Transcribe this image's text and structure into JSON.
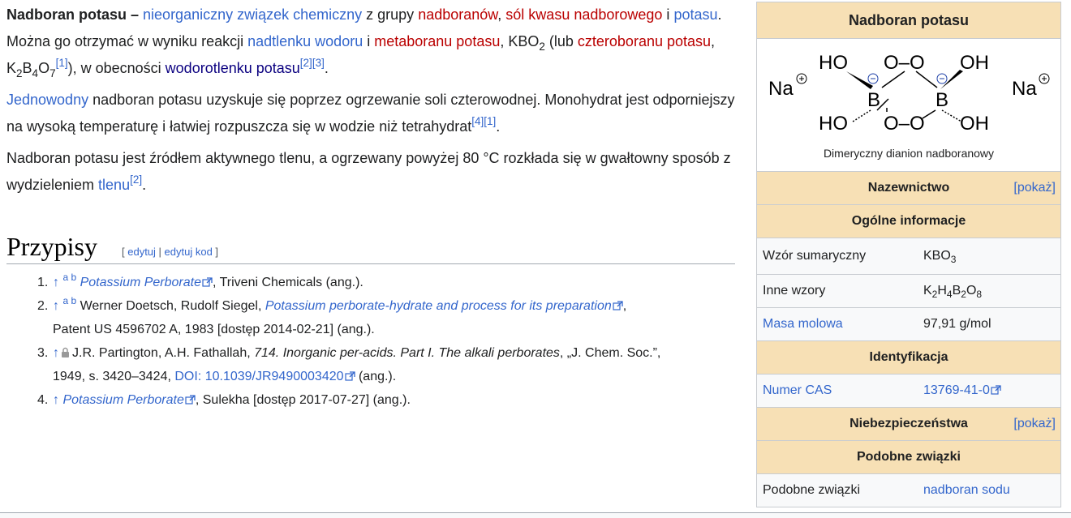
{
  "paragraphs": {
    "p1": {
      "title": "Nadboran potasu",
      "dash": " – ",
      "link1": "nieorganiczny związek chemiczny",
      "t1": " z grupy ",
      "link2": "nadboranów",
      "t2": ", ",
      "link3": "sól kwasu nadborowego",
      "t3": " i ",
      "link4": "potasu",
      "t4": ". Można go otrzymać w wyniku reakcji ",
      "link5": "nadtlenku wodoru",
      "t5": " i ",
      "link6": "metaboranu potasu",
      "t6": ", KBO",
      "sub1": "2",
      "t7": " (lub ",
      "link7": "czteroboranu potasu",
      "t8": ", K",
      "sub2": "2",
      "t9": "B",
      "sub3": "4",
      "t10": "O",
      "sub4": "7",
      "ref1": "[1]",
      "t11": "), w obecności ",
      "link8": "wodorotlenku potasu",
      "ref2": "[2]",
      "ref3": "[3]",
      "t12": "."
    },
    "p2": {
      "link1": "Jednowodny",
      "t1": " nadboran potasu uzyskuje się poprzez ogrzewanie soli czterowodnej. Monohydrat jest odporniejszy na wysoką temperaturę i łatwiej rozpuszcza się w wodzie niż tetrahydrat",
      "ref1": "[4]",
      "ref2": "[1]",
      "t2": "."
    },
    "p3": {
      "t1": "Nadboran potasu jest źródłem aktywnego tlenu, a ogrzewany powyżej 80 °C rozkłada się w gwałtowny sposób z wydzieleniem ",
      "link1": "tlenu",
      "ref1": "[2]",
      "t2": "."
    }
  },
  "references": {
    "heading": "Przypisy",
    "edit_bracket_open": "[ ",
    "edit_link": "edytuj",
    "edit_sep": " | ",
    "edit_code_link": "edytuj kod",
    "edit_bracket_close": " ]",
    "items": [
      {
        "num": "1.",
        "arrow": "↑",
        "ab": "a b",
        "title": "Potassium Perborate",
        "rest": ", Triveni Chemicals (ang.)."
      },
      {
        "num": "2.",
        "arrow": "↑",
        "ab": "a b",
        "authors": "Werner Doetsch, Rudolf Siegel, ",
        "title": "Potassium perborate-hydrate and process for its preparation",
        "rest": ",",
        "line2": "Patent US 4596702 A, 1983 [dostęp 2014-02-21] (ang.)."
      },
      {
        "num": "3.",
        "arrow": "↑",
        "authors": "J.R. Partington, A.H. Fathallah, ",
        "title": "714. Inorganic per-acids. Part I. The alkali perborates",
        "rest": ", „J. Chem. Soc.”,",
        "line2a": "1949, s. 3420–3424, ",
        "doi": "DOI: 10.1039/JR9490003420",
        "line2b": " (ang.)."
      },
      {
        "num": "4.",
        "arrow": "↑",
        "title": "Potassium Perborate",
        "rest": ", Sulekha [dostęp 2017-07-27] (ang.)."
      }
    ]
  },
  "infobox": {
    "title": "Nadboran potasu",
    "structure": {
      "na_left": "Na",
      "na_right": "Na",
      "ho_tl": "HO",
      "ho_bl": "HO",
      "oh_tr": "OH",
      "oh_br": "OH",
      "b1": "B",
      "b2": "B",
      "o_top": "O–O",
      "o_bottom": "O–O",
      "caption": "Dimeryczny dianion nadboranowy"
    },
    "section_naming": "Nazewnictwo",
    "pokaz": "[pokaż]",
    "section_general": "Ogólne informacje",
    "rows_general": [
      {
        "key": "Wzór sumaryczny",
        "val_main": "KBO",
        "val_sub": "3"
      },
      {
        "key": "Inne wzory",
        "val_main": "K2H4B2O8"
      },
      {
        "key": "Masa molowa",
        "val": "97,91 g/mol"
      }
    ],
    "section_ident": "Identyfikacja",
    "row_cas": {
      "key": "Numer CAS",
      "val": "13769-41-0"
    },
    "section_hazards": "Niebezpieczeństwa",
    "section_similar": "Podobne związki",
    "row_similar": {
      "key": "Podobne związki",
      "val": "nadboran sodu"
    }
  }
}
